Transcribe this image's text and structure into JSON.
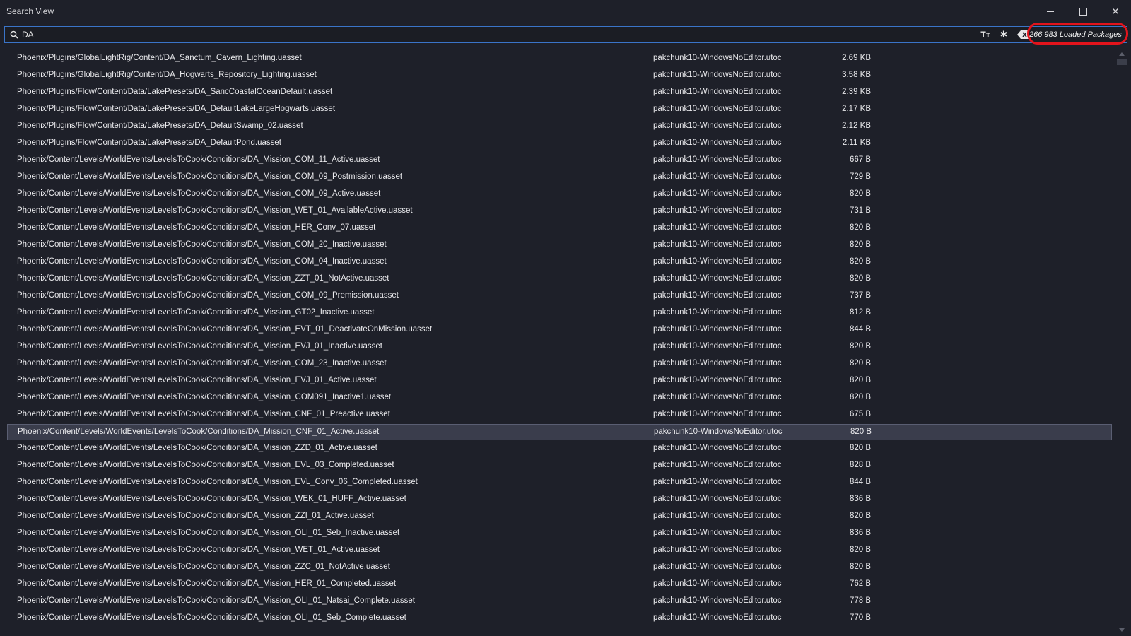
{
  "window": {
    "title": "Search View",
    "minimize_icon": "minimize-icon",
    "maximize_icon": "maximize-icon",
    "close_icon": "close-icon",
    "close_glyph": "✕"
  },
  "search": {
    "value": "DA",
    "icon": "search-icon",
    "match_case_glyph": "Tт",
    "regex_glyph": "✱",
    "loaded_packages": "266 983 Loaded Packages",
    "highlight_color": "#e3141c"
  },
  "results": [
    {
      "path": "Phoenix/Plugins/GlobalLightRig/Content/DA_Sanctum_Cavern_Lighting.uasset",
      "package": "pakchunk10-WindowsNoEditor.utoc",
      "size": "2.69 KB"
    },
    {
      "path": "Phoenix/Plugins/GlobalLightRig/Content/DA_Hogwarts_Repository_Lighting.uasset",
      "package": "pakchunk10-WindowsNoEditor.utoc",
      "size": "3.58 KB"
    },
    {
      "path": "Phoenix/Plugins/Flow/Content/Data/LakePresets/DA_SancCoastalOceanDefault.uasset",
      "package": "pakchunk10-WindowsNoEditor.utoc",
      "size": "2.39 KB"
    },
    {
      "path": "Phoenix/Plugins/Flow/Content/Data/LakePresets/DA_DefaultLakeLargeHogwarts.uasset",
      "package": "pakchunk10-WindowsNoEditor.utoc",
      "size": "2.17 KB"
    },
    {
      "path": "Phoenix/Plugins/Flow/Content/Data/LakePresets/DA_DefaultSwamp_02.uasset",
      "package": "pakchunk10-WindowsNoEditor.utoc",
      "size": "2.12 KB"
    },
    {
      "path": "Phoenix/Plugins/Flow/Content/Data/LakePresets/DA_DefaultPond.uasset",
      "package": "pakchunk10-WindowsNoEditor.utoc",
      "size": "2.11 KB"
    },
    {
      "path": "Phoenix/Content/Levels/WorldEvents/LevelsToCook/Conditions/DA_Mission_COM_11_Active.uasset",
      "package": "pakchunk10-WindowsNoEditor.utoc",
      "size": "667 B"
    },
    {
      "path": "Phoenix/Content/Levels/WorldEvents/LevelsToCook/Conditions/DA_Mission_COM_09_Postmission.uasset",
      "package": "pakchunk10-WindowsNoEditor.utoc",
      "size": "729 B"
    },
    {
      "path": "Phoenix/Content/Levels/WorldEvents/LevelsToCook/Conditions/DA_Mission_COM_09_Active.uasset",
      "package": "pakchunk10-WindowsNoEditor.utoc",
      "size": "820 B"
    },
    {
      "path": "Phoenix/Content/Levels/WorldEvents/LevelsToCook/Conditions/DA_Mission_WET_01_AvailableActive.uasset",
      "package": "pakchunk10-WindowsNoEditor.utoc",
      "size": "731 B"
    },
    {
      "path": "Phoenix/Content/Levels/WorldEvents/LevelsToCook/Conditions/DA_Mission_HER_Conv_07.uasset",
      "package": "pakchunk10-WindowsNoEditor.utoc",
      "size": "820 B"
    },
    {
      "path": "Phoenix/Content/Levels/WorldEvents/LevelsToCook/Conditions/DA_Mission_COM_20_Inactive.uasset",
      "package": "pakchunk10-WindowsNoEditor.utoc",
      "size": "820 B"
    },
    {
      "path": "Phoenix/Content/Levels/WorldEvents/LevelsToCook/Conditions/DA_Mission_COM_04_Inactive.uasset",
      "package": "pakchunk10-WindowsNoEditor.utoc",
      "size": "820 B"
    },
    {
      "path": "Phoenix/Content/Levels/WorldEvents/LevelsToCook/Conditions/DA_Mission_ZZT_01_NotActive.uasset",
      "package": "pakchunk10-WindowsNoEditor.utoc",
      "size": "820 B"
    },
    {
      "path": "Phoenix/Content/Levels/WorldEvents/LevelsToCook/Conditions/DA_Mission_COM_09_Premission.uasset",
      "package": "pakchunk10-WindowsNoEditor.utoc",
      "size": "737 B"
    },
    {
      "path": "Phoenix/Content/Levels/WorldEvents/LevelsToCook/Conditions/DA_Mission_GT02_Inactive.uasset",
      "package": "pakchunk10-WindowsNoEditor.utoc",
      "size": "812 B"
    },
    {
      "path": "Phoenix/Content/Levels/WorldEvents/LevelsToCook/Conditions/DA_Mission_EVT_01_DeactivateOnMission.uasset",
      "package": "pakchunk10-WindowsNoEditor.utoc",
      "size": "844 B"
    },
    {
      "path": "Phoenix/Content/Levels/WorldEvents/LevelsToCook/Conditions/DA_Mission_EVJ_01_Inactive.uasset",
      "package": "pakchunk10-WindowsNoEditor.utoc",
      "size": "820 B"
    },
    {
      "path": "Phoenix/Content/Levels/WorldEvents/LevelsToCook/Conditions/DA_Mission_COM_23_Inactive.uasset",
      "package": "pakchunk10-WindowsNoEditor.utoc",
      "size": "820 B"
    },
    {
      "path": "Phoenix/Content/Levels/WorldEvents/LevelsToCook/Conditions/DA_Mission_EVJ_01_Active.uasset",
      "package": "pakchunk10-WindowsNoEditor.utoc",
      "size": "820 B"
    },
    {
      "path": "Phoenix/Content/Levels/WorldEvents/LevelsToCook/Conditions/DA_Mission_COM091_Inactive1.uasset",
      "package": "pakchunk10-WindowsNoEditor.utoc",
      "size": "820 B"
    },
    {
      "path": "Phoenix/Content/Levels/WorldEvents/LevelsToCook/Conditions/DA_Mission_CNF_01_Preactive.uasset",
      "package": "pakchunk10-WindowsNoEditor.utoc",
      "size": "675 B"
    },
    {
      "path": "Phoenix/Content/Levels/WorldEvents/LevelsToCook/Conditions/DA_Mission_CNF_01_Active.uasset",
      "package": "pakchunk10-WindowsNoEditor.utoc",
      "size": "820 B",
      "selected": true
    },
    {
      "path": "Phoenix/Content/Levels/WorldEvents/LevelsToCook/Conditions/DA_Mission_ZZD_01_Active.uasset",
      "package": "pakchunk10-WindowsNoEditor.utoc",
      "size": "820 B"
    },
    {
      "path": "Phoenix/Content/Levels/WorldEvents/LevelsToCook/Conditions/DA_Mission_EVL_03_Completed.uasset",
      "package": "pakchunk10-WindowsNoEditor.utoc",
      "size": "828 B"
    },
    {
      "path": "Phoenix/Content/Levels/WorldEvents/LevelsToCook/Conditions/DA_Mission_EVL_Conv_06_Completed.uasset",
      "package": "pakchunk10-WindowsNoEditor.utoc",
      "size": "844 B"
    },
    {
      "path": "Phoenix/Content/Levels/WorldEvents/LevelsToCook/Conditions/DA_Mission_WEK_01_HUFF_Active.uasset",
      "package": "pakchunk10-WindowsNoEditor.utoc",
      "size": "836 B"
    },
    {
      "path": "Phoenix/Content/Levels/WorldEvents/LevelsToCook/Conditions/DA_Mission_ZZI_01_Active.uasset",
      "package": "pakchunk10-WindowsNoEditor.utoc",
      "size": "820 B"
    },
    {
      "path": "Phoenix/Content/Levels/WorldEvents/LevelsToCook/Conditions/DA_Mission_OLI_01_Seb_Inactive.uasset",
      "package": "pakchunk10-WindowsNoEditor.utoc",
      "size": "836 B"
    },
    {
      "path": "Phoenix/Content/Levels/WorldEvents/LevelsToCook/Conditions/DA_Mission_WET_01_Active.uasset",
      "package": "pakchunk10-WindowsNoEditor.utoc",
      "size": "820 B"
    },
    {
      "path": "Phoenix/Content/Levels/WorldEvents/LevelsToCook/Conditions/DA_Mission_ZZC_01_NotActive.uasset",
      "package": "pakchunk10-WindowsNoEditor.utoc",
      "size": "820 B"
    },
    {
      "path": "Phoenix/Content/Levels/WorldEvents/LevelsToCook/Conditions/DA_Mission_HER_01_Completed.uasset",
      "package": "pakchunk10-WindowsNoEditor.utoc",
      "size": "762 B"
    },
    {
      "path": "Phoenix/Content/Levels/WorldEvents/LevelsToCook/Conditions/DA_Mission_OLI_01_Natsai_Complete.uasset",
      "package": "pakchunk10-WindowsNoEditor.utoc",
      "size": "778 B"
    },
    {
      "path": "Phoenix/Content/Levels/WorldEvents/LevelsToCook/Conditions/DA_Mission_OLI_01_Seb_Complete.uasset",
      "package": "pakchunk10-WindowsNoEditor.utoc",
      "size": "770 B"
    }
  ]
}
